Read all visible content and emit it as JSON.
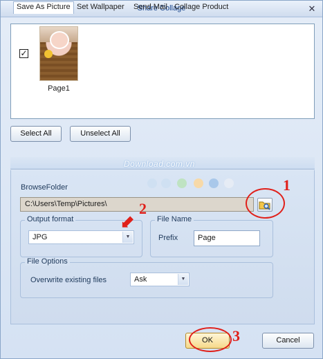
{
  "window": {
    "title": "Share Collage",
    "close_glyph": "✕"
  },
  "pages": {
    "items": [
      {
        "label": "Page1",
        "checked": true,
        "check_glyph": "✓",
        "icon": "page-thumbnail"
      }
    ]
  },
  "selection_buttons": {
    "select_all": "Select All",
    "unselect_all": "Unselect All"
  },
  "tabs": [
    {
      "label": "Save As Picture",
      "active": true
    },
    {
      "label": "Set Wallpaper",
      "active": false
    },
    {
      "label": "Send Mail",
      "active": false
    },
    {
      "label": "Collage Product",
      "active": false
    }
  ],
  "watermark": {
    "text": "Download.com.vn",
    "dot_colors": [
      "#cfe0f2",
      "#cfe0f2",
      "#bfe3c2",
      "#f7d9a8",
      "#a9c8ea",
      "#e6ecf5"
    ]
  },
  "browse": {
    "label": "BrowseFolder",
    "path": "C:\\Users\\Temp\\Pictures\\",
    "button_icon": "browse-folder-icon"
  },
  "output_format": {
    "group_title": "Output format",
    "value": "JPG",
    "arrow_glyph": "▼"
  },
  "file_name": {
    "group_title": "File Name",
    "prefix_label": "Prefix",
    "prefix_value": "Page"
  },
  "file_options": {
    "group_title": "File Options",
    "overwrite_label": "Overwrite existing files",
    "overwrite_value": "Ask",
    "arrow_glyph": "▼"
  },
  "footer": {
    "ok": "OK",
    "cancel": "Cancel"
  },
  "annotations": {
    "color": "#e0201a",
    "items": [
      {
        "number": "1"
      },
      {
        "number": "2",
        "arrow_glyph": "⬋"
      },
      {
        "number": "3"
      }
    ]
  }
}
